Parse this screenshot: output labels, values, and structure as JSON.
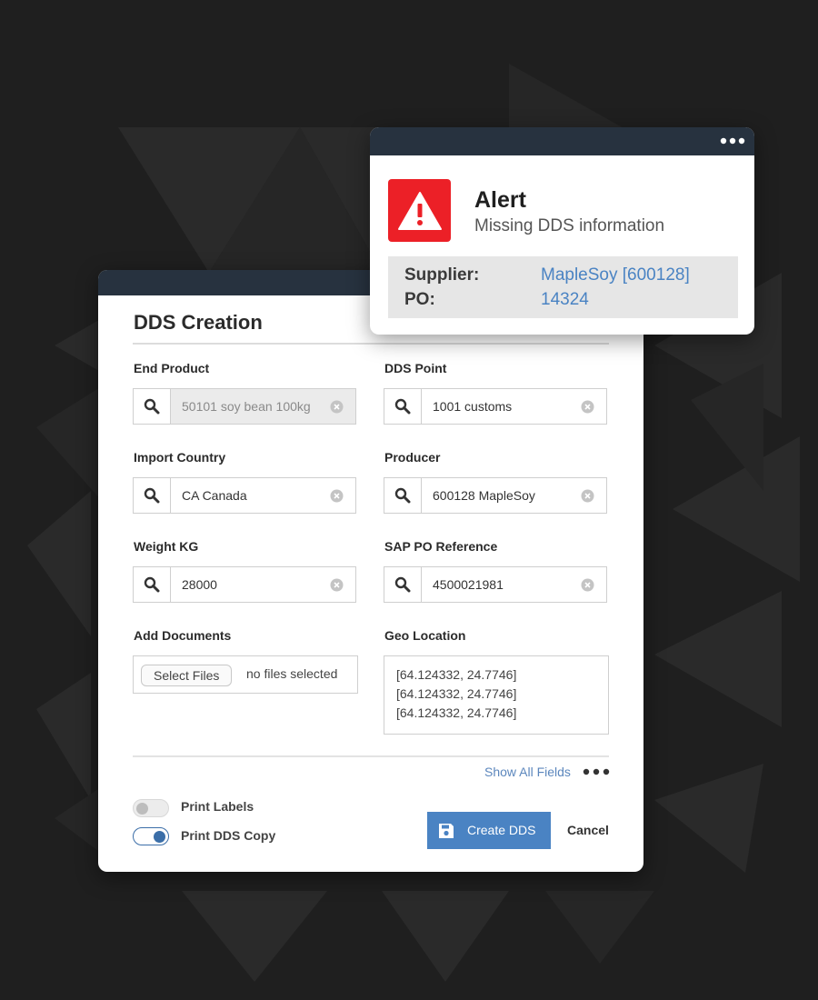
{
  "form": {
    "title": "DDS Creation",
    "fields": {
      "end_product": {
        "label": "End Product",
        "value": "50101 soy bean 100kg"
      },
      "dds_point": {
        "label": "DDS Point",
        "value": "1001 customs"
      },
      "import_country": {
        "label": "Import Country",
        "value": "CA Canada"
      },
      "producer": {
        "label": "Producer",
        "value": "600128 MapleSoy"
      },
      "weight_kg": {
        "label": "Weight KG",
        "value": "28000"
      },
      "sap_po_reference": {
        "label": "SAP PO Reference",
        "value": "4500021981"
      }
    },
    "documents": {
      "label": "Add Documents",
      "button": "Select Files",
      "status": "no files selected"
    },
    "geo_location": {
      "label": "Geo Location",
      "lines": [
        "[64.124332, 24.7746]",
        "[64.124332, 24.7746]",
        "[64.124332, 24.7746]"
      ]
    },
    "show_all_fields": "Show All Fields",
    "toggles": {
      "print_labels": {
        "label": "Print Labels",
        "on": false
      },
      "print_dds_copy": {
        "label": "Print DDS Copy",
        "on": true
      }
    },
    "create_button": "Create DDS",
    "cancel_button": "Cancel"
  },
  "alert": {
    "title": "Alert",
    "message": "Missing DDS information",
    "rows": [
      {
        "key": "Supplier:",
        "value": "MapleSoy [600128]"
      },
      {
        "key": "PO:",
        "value": "14324"
      }
    ]
  },
  "colors": {
    "background": "#1f1f1f",
    "header_bar": "#27323f",
    "accent_blue": "#4a83c3",
    "alert_red": "#ec2027"
  },
  "icons": [
    "search-icon",
    "clear-icon",
    "more-icon",
    "save-icon",
    "warning-icon"
  ]
}
